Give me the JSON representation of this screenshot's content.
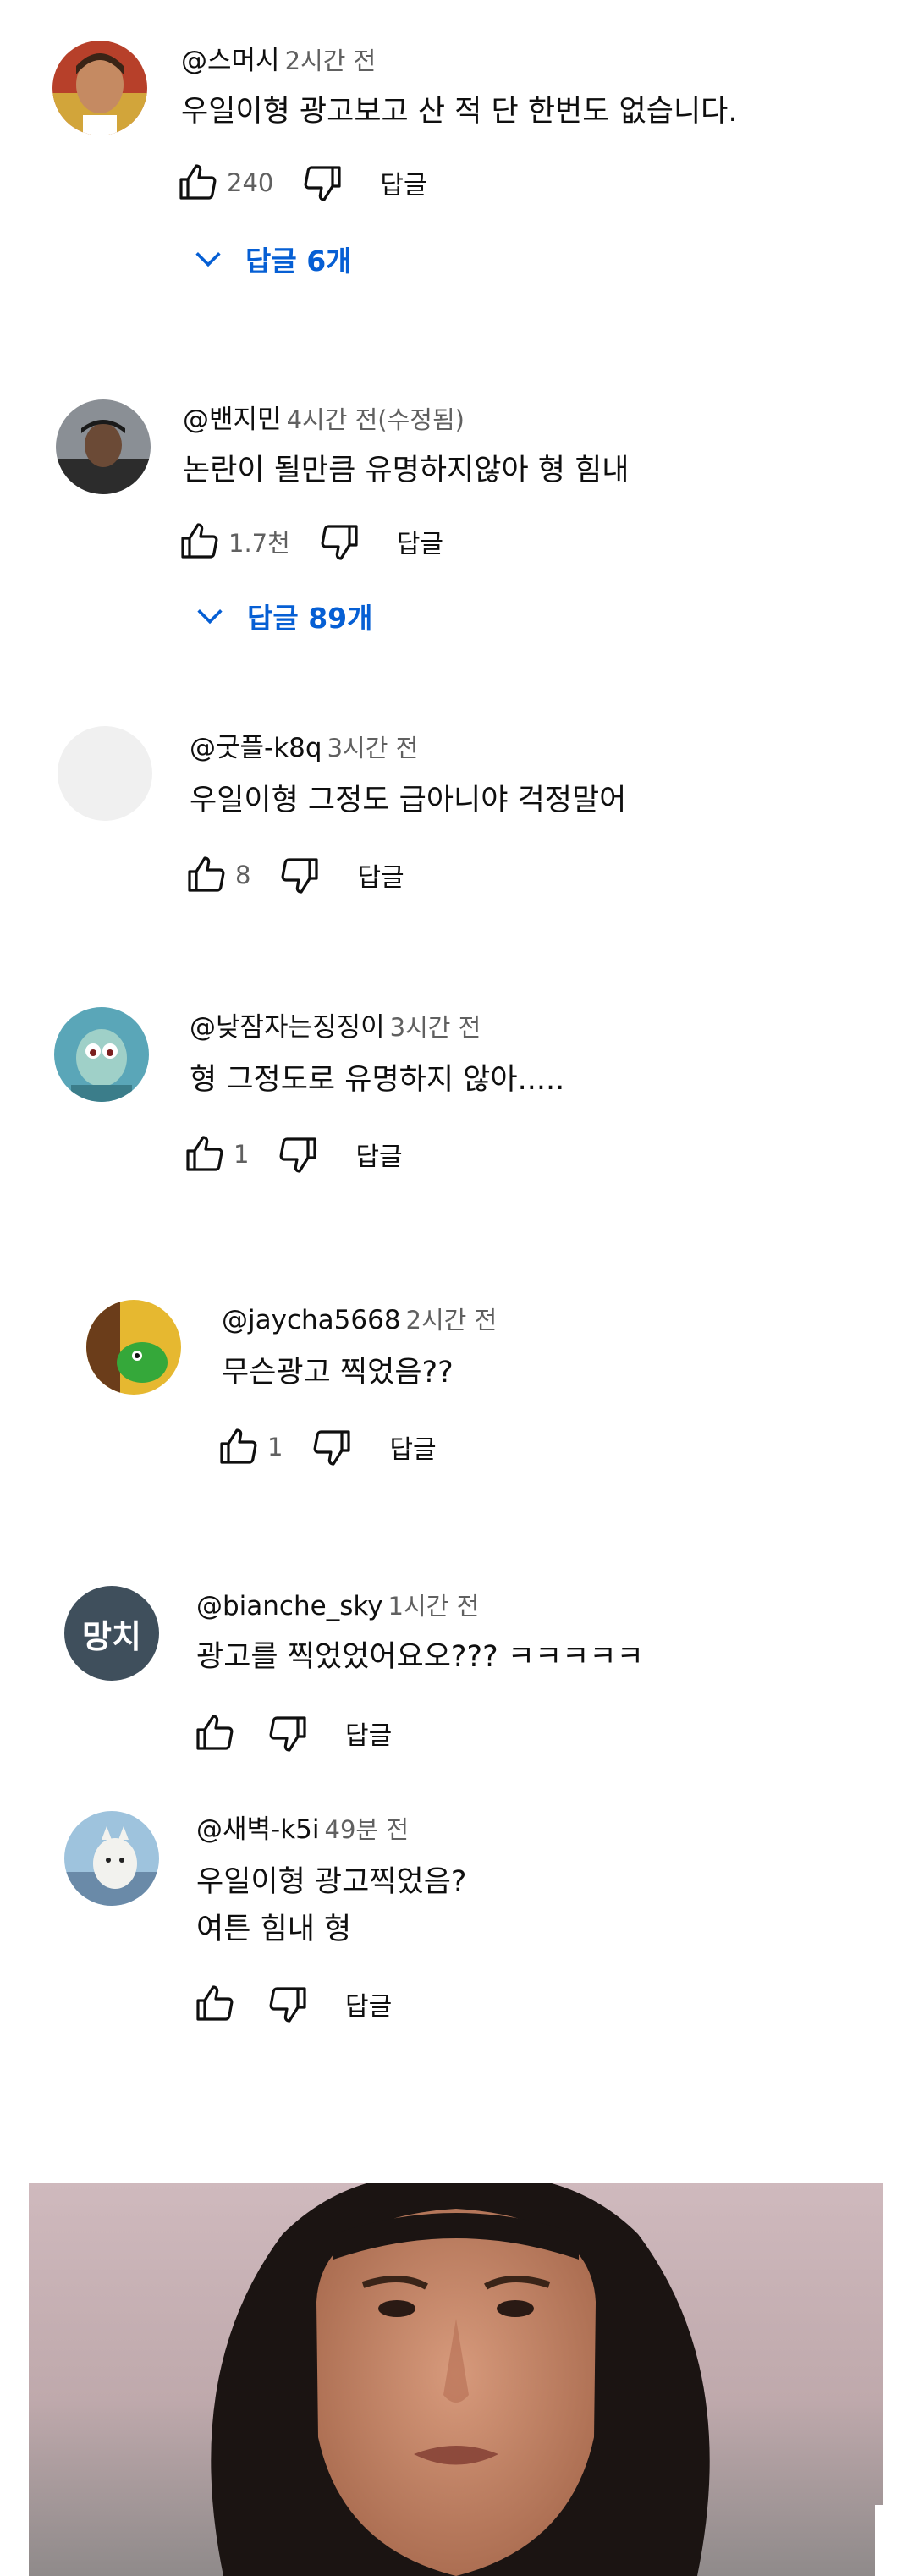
{
  "comments": [
    {
      "author": "@스머시",
      "time": "2시간 전",
      "text": "우일이형 광고보고 산 적 단 한번도 없습니다.",
      "likes": "240",
      "reply_label": "답글",
      "replies_label": "답글 6개"
    },
    {
      "author": "@밴지민",
      "time": "4시간 전(수정됨)",
      "text": "논란이 될만큼 유명하지않아 형 힘내",
      "likes": "1.7천",
      "reply_label": "답글",
      "replies_label": "답글 89개"
    },
    {
      "author": "@굿플-k8q",
      "time": "3시간 전",
      "text": "우일이형 그정도 급아니야 걱정말어",
      "likes": "8",
      "reply_label": "답글"
    },
    {
      "author": "@낮잠자는징징이",
      "time": "3시간 전",
      "text": "형 그정도로 유명하지 않아.....",
      "likes": "1",
      "reply_label": "답글"
    },
    {
      "author": "@jaycha5668",
      "time": "2시간 전",
      "text": "무슨광고 찍었음??",
      "likes": "1",
      "reply_label": "답글"
    },
    {
      "author": "@bianche_sky",
      "time": "1시간 전",
      "text": "광고를 찍었었어요오??? ㅋㅋㅋㅋㅋ",
      "avatar_text": "망치",
      "reply_label": "답글"
    },
    {
      "author": "@새벽-k5i",
      "time": "49분 전",
      "text": "우일이형 광고찍었음?\n여튼 힘내 형",
      "reply_label": "답글"
    }
  ],
  "colors": {
    "link_blue": "#065fd4",
    "muted": "#606060",
    "avatar_placeholder": "#f0f0f0",
    "mangchi_avatar_bg": "#3f4f5c"
  }
}
